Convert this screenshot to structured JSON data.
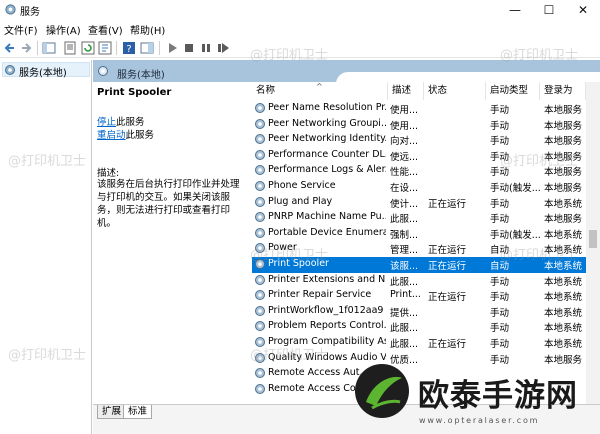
{
  "window": {
    "title": "服务",
    "minimize": "—",
    "maximize": "☐",
    "close": "✕"
  },
  "menu": [
    "文件(F)",
    "操作(A)",
    "查看(V)",
    "帮助(H)"
  ],
  "tree": {
    "item": "服务(本地)"
  },
  "panel": {
    "header": "服务(本地)"
  },
  "description": {
    "service_name": "Print Spooler",
    "stop_link": "停止",
    "stop_suffix": "此服务",
    "restart_link": "重启动",
    "restart_suffix": "此服务",
    "label": "描述:",
    "text": "该服务在后台执行打印作业并处理与打印机的交互。如果关闭该服务，则无法进行打印或查看打印机。"
  },
  "columns": [
    "名称",
    "描述",
    "状态",
    "启动类型",
    "登录为"
  ],
  "rows": [
    {
      "name": "Peer Name Resolution Pr...",
      "desc": "使用...",
      "status": "",
      "startup": "手动",
      "logon": "本地服务"
    },
    {
      "name": "Peer Networking Groupi...",
      "desc": "使用...",
      "status": "",
      "startup": "手动",
      "logon": "本地服务"
    },
    {
      "name": "Peer Networking Identity...",
      "desc": "向对...",
      "status": "",
      "startup": "手动",
      "logon": "本地服务"
    },
    {
      "name": "Performance Counter DL...",
      "desc": "使远...",
      "status": "",
      "startup": "手动",
      "logon": "本地服务"
    },
    {
      "name": "Performance Logs & Aler...",
      "desc": "性能...",
      "status": "",
      "startup": "手动",
      "logon": "本地服务"
    },
    {
      "name": "Phone Service",
      "desc": "在设...",
      "status": "",
      "startup": "手动(触发...",
      "logon": "本地服务"
    },
    {
      "name": "Plug and Play",
      "desc": "使计...",
      "status": "正在运行",
      "startup": "手动",
      "logon": "本地系统"
    },
    {
      "name": "PNRP Machine Name Pu...",
      "desc": "此服...",
      "status": "",
      "startup": "手动",
      "logon": "本地服务"
    },
    {
      "name": "Portable Device Enumera...",
      "desc": "强制...",
      "status": "",
      "startup": "手动(触发...",
      "logon": "本地系统"
    },
    {
      "name": "Power",
      "desc": "管理...",
      "status": "正在运行",
      "startup": "自动",
      "logon": "本地系统"
    },
    {
      "name": "Print Spooler",
      "desc": "该服...",
      "status": "正在运行",
      "startup": "自动",
      "logon": "本地系统"
    },
    {
      "name": "Printer Extensions and N...",
      "desc": "此服...",
      "status": "",
      "startup": "手动",
      "logon": "本地系统"
    },
    {
      "name": "Printer Repair Service",
      "desc": "Print...",
      "status": "正在运行",
      "startup": "手动",
      "logon": "本地系统"
    },
    {
      "name": "PrintWorkflow_1f012aa9",
      "desc": "提供...",
      "status": "",
      "startup": "手动",
      "logon": "本地系统"
    },
    {
      "name": "Problem Reports Control...",
      "desc": "此服...",
      "status": "",
      "startup": "手动",
      "logon": "本地系统"
    },
    {
      "name": "Program Compatibility As...",
      "desc": "此服...",
      "status": "正在运行",
      "startup": "手动",
      "logon": "本地系统"
    },
    {
      "name": "Quality Windows Audio V...",
      "desc": "优质...",
      "status": "",
      "startup": "手动",
      "logon": "本地服务"
    },
    {
      "name": "Remote Access Aut...",
      "desc": "",
      "status": "",
      "startup": "",
      "logon": ""
    },
    {
      "name": "Remote Access Co...",
      "desc": "",
      "status": "",
      "startup": "",
      "logon": ""
    }
  ],
  "selected_row_index": 10,
  "tabs": [
    "扩展",
    "标准"
  ],
  "watermark": "@打印机卫士",
  "brand": {
    "name": "欧泰手游网",
    "url": "www.opteralaser.com"
  },
  "colors": {
    "selection": "#0078d7",
    "header_band": "#a8c3dc",
    "link": "#0066cc",
    "logo_green": "#5cb531"
  }
}
